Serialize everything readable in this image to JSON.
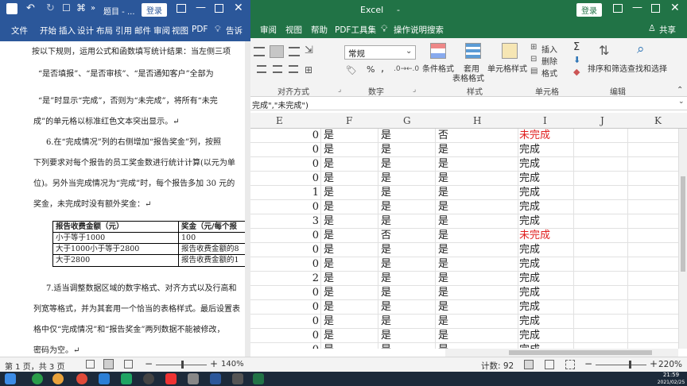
{
  "word": {
    "title": "题目 - ...",
    "login_button": "登录",
    "tabs": [
      "文件",
      "开始",
      "插入",
      "设计",
      "布局",
      "引用",
      "邮件",
      "审阅",
      "视图",
      "PDF"
    ],
    "tell_me": "告诉",
    "paragraphs": [
      "按以下规则，运用公式和函数填写统计结果：当左侧三项",
      "“是否填报”、“是否审核”、“是否通知客户”全部为",
      "“是”时显示“完成”，否则为“未完成”，将所有“未完",
      "成”的单元格以标准红色文本突出显示。↵",
      "6.在“完成情况”列的右侧增加“报告奖金”列，按照",
      "下列要求对每个报告的员工奖金数进行统计计算(以元为单",
      "位)。另外当完成情况为“完成”时，每个报告多加 30 元的",
      "奖金，未完成时没有额外奖金：↵",
      "7.适当调整数据区域的数字格式、对齐方式以及行高和",
      "列宽等格式，并为其套用一个恰当的表格样式。最后设置表",
      "格中仅“完成情况”和“报告奖金”两列数据不能被修改，",
      "密码为空。↵"
    ],
    "table": {
      "headers": [
        "报告收费金额（元）",
        "奖金（元/每个报"
      ],
      "rows": [
        [
          "小于等于1000",
          "100"
        ],
        [
          "大于1000小于等于2800",
          "报告收费金额的8"
        ],
        [
          "大于2800",
          "报告收费金额的1"
        ]
      ]
    },
    "status": {
      "page": "第 1 页，共 3 页",
      "zoom": "140%"
    }
  },
  "excel": {
    "title": "Excel",
    "login_button": "登录",
    "tabs": [
      "审阅",
      "视图",
      "帮助",
      "PDF工具集",
      "操作说明搜索"
    ],
    "share": "共享",
    "ribbon": {
      "number_format": "常规",
      "groups": {
        "alignment": "对齐方式",
        "number": "数字",
        "styles": "样式",
        "cells": "单元格",
        "editing": "编辑"
      },
      "buttons": {
        "conditional": "条件格式",
        "table_format_1": "套用",
        "table_format_2": "表格格式",
        "cell_styles": "单元格样式",
        "insert": "插入",
        "delete": "删除",
        "format": "格式",
        "sort_filter": "排序和筛选",
        "find_select": "查找和选择",
        "percent": "%",
        "comma": ","
      }
    },
    "formula_text": "完成\",\"未完成\")",
    "columns": [
      "E",
      "F",
      "G",
      "H",
      "I",
      "J",
      "K"
    ],
    "rows": [
      {
        "e": "0",
        "f": "是",
        "g": "是",
        "h": "否",
        "i": "未完成",
        "red": true
      },
      {
        "e": "0",
        "f": "是",
        "g": "是",
        "h": "是",
        "i": "完成",
        "red": false
      },
      {
        "e": "0",
        "f": "是",
        "g": "是",
        "h": "是",
        "i": "完成",
        "red": false
      },
      {
        "e": "0",
        "f": "是",
        "g": "是",
        "h": "是",
        "i": "完成",
        "red": false
      },
      {
        "e": "1",
        "f": "是",
        "g": "是",
        "h": "是",
        "i": "完成",
        "red": false
      },
      {
        "e": "0",
        "f": "是",
        "g": "是",
        "h": "是",
        "i": "完成",
        "red": false
      },
      {
        "e": "3",
        "f": "是",
        "g": "是",
        "h": "是",
        "i": "完成",
        "red": false
      },
      {
        "e": "0",
        "f": "是",
        "g": "否",
        "h": "是",
        "i": "未完成",
        "red": true
      },
      {
        "e": "0",
        "f": "是",
        "g": "是",
        "h": "是",
        "i": "完成",
        "red": false
      },
      {
        "e": "0",
        "f": "是",
        "g": "是",
        "h": "是",
        "i": "完成",
        "red": false
      },
      {
        "e": "2",
        "f": "是",
        "g": "是",
        "h": "是",
        "i": "完成",
        "red": false
      },
      {
        "e": "0",
        "f": "是",
        "g": "是",
        "h": "是",
        "i": "完成",
        "red": false
      },
      {
        "e": "0",
        "f": "是",
        "g": "是",
        "h": "是",
        "i": "完成",
        "red": false
      },
      {
        "e": "0",
        "f": "是",
        "g": "是",
        "h": "是",
        "i": "完成",
        "red": false
      },
      {
        "e": "0",
        "f": "是",
        "g": "是",
        "h": "是",
        "i": "完成",
        "red": false
      },
      {
        "e": "0",
        "f": "是",
        "g": "是",
        "h": "是",
        "i": "完成",
        "red": false
      }
    ],
    "status": {
      "count": "计数: 92",
      "zoom": "220%"
    }
  },
  "taskbar": {
    "time": "21:59",
    "date": "2021/02/25"
  },
  "colors": {
    "word_blue": "#2b579a",
    "excel_green": "#217346",
    "red_text": "#e02020"
  }
}
